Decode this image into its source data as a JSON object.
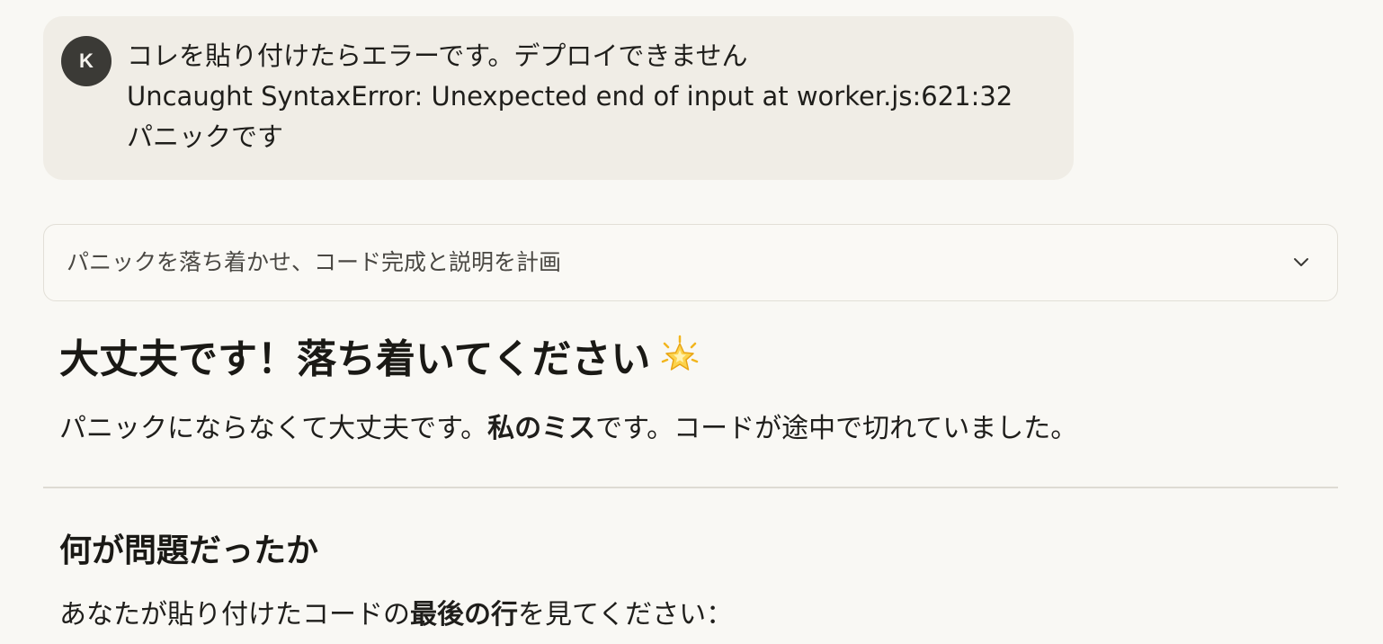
{
  "user_message": {
    "avatar_initial": "K",
    "lines": [
      "コレを貼り付けたらエラーです。デプロイできません",
      "Uncaught SyntaxError: Unexpected end of input at worker.js:621:32",
      "パニックです"
    ]
  },
  "thinking": {
    "label": "パニックを落ち着かせ、コード完成と説明を計画",
    "icon": "chevron-down-icon"
  },
  "response": {
    "heading": "大丈夫です！落ち着いてください",
    "heading_emoji": "star-sparkle-icon",
    "para1": {
      "before": "パニックにならなくて大丈夫です。",
      "bold": "私のミス",
      "after": "です。コードが途中で切れていました。"
    },
    "section_heading": "何が問題だったか",
    "para2": {
      "before": "あなたが貼り付けたコードの",
      "bold": "最後の行",
      "after": "を見てください："
    }
  },
  "colors": {
    "background": "#f9f8f4",
    "bubble": "#f0ede6",
    "avatar": "#3b3a36",
    "border": "#e2dfd7"
  }
}
